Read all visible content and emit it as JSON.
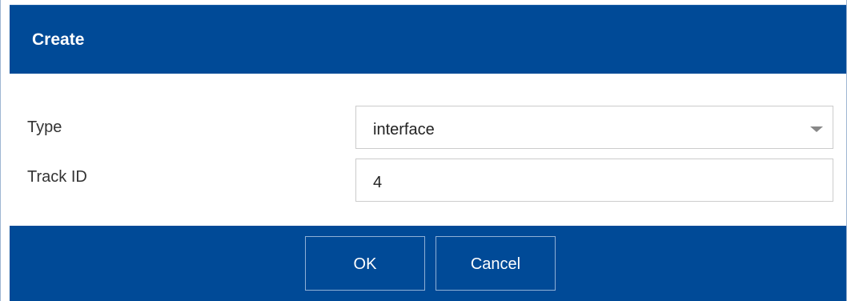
{
  "dialog": {
    "title": "Create"
  },
  "form": {
    "type_label": "Type",
    "type_value": "interface",
    "track_id_label": "Track ID",
    "track_id_value": "4"
  },
  "footer": {
    "ok_label": "OK",
    "cancel_label": "Cancel"
  },
  "colors": {
    "header_bg": "#004a97",
    "footer_bg": "#004a97",
    "field_border": "#cccccc"
  },
  "icons": {
    "type_dropdown": "chevron-down-icon"
  }
}
